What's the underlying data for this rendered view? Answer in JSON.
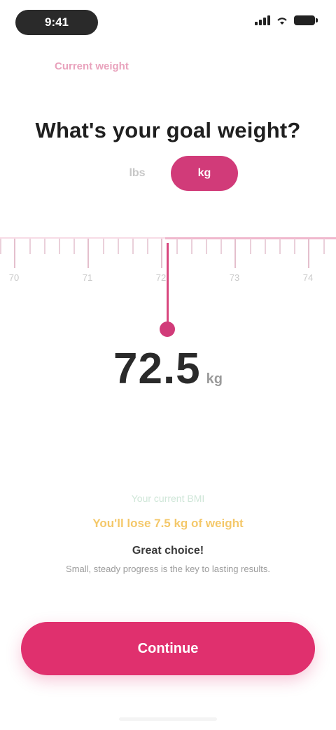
{
  "status_bar": {
    "time": "9:41",
    "icons": [
      "signal-icon",
      "wifi-icon",
      "battery-icon"
    ]
  },
  "header": {
    "step_link": "Current weight"
  },
  "question": {
    "text": "What's your goal weight?"
  },
  "unit_toggle": {
    "options": [
      "lbs",
      "kg"
    ],
    "selected": "kg"
  },
  "ruler": {
    "labels": [
      "70",
      "71",
      "72",
      "73",
      "74"
    ]
  },
  "value": {
    "number": "72.5",
    "unit": "kg"
  },
  "info_card": {
    "caption": "Your current BMI",
    "highlight": "You'll lose 7.5 kg of weight",
    "title": "Great choice!",
    "description": "Small, steady progress is the key to lasting results."
  },
  "cta": {
    "label": "Continue"
  },
  "colors": {
    "accent": "#e0306e",
    "toggle_active": "#d13b79",
    "highlight": "#f4c86a"
  }
}
